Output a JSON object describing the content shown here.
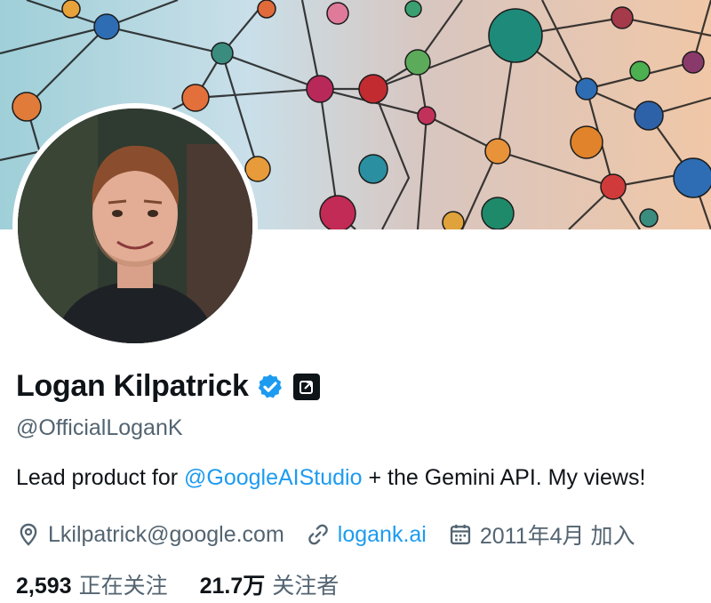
{
  "profile": {
    "name": "Logan Kilpatrick",
    "handle": "@OfficialLoganK",
    "bio_prefix": "Lead product for ",
    "bio_mention": "@GoogleAIStudio",
    "bio_suffix": " + the Gemini API. My views!",
    "email": "Lkilpatrick@google.com",
    "website": "logank.ai",
    "joined": "2011年4月 加入",
    "following_count": "2,593",
    "following_label": "正在关注",
    "followers_count": "21.7万",
    "followers_label": "关注者"
  },
  "icons": {
    "verified": "verified-badge-icon",
    "affiliate": "affiliate-badge-icon",
    "location": "location-pin-icon",
    "link": "link-icon",
    "calendar": "calendar-icon"
  },
  "colors": {
    "link": "#1d9bf0",
    "secondary_text": "#536471",
    "verified": "#1d9bf0"
  }
}
